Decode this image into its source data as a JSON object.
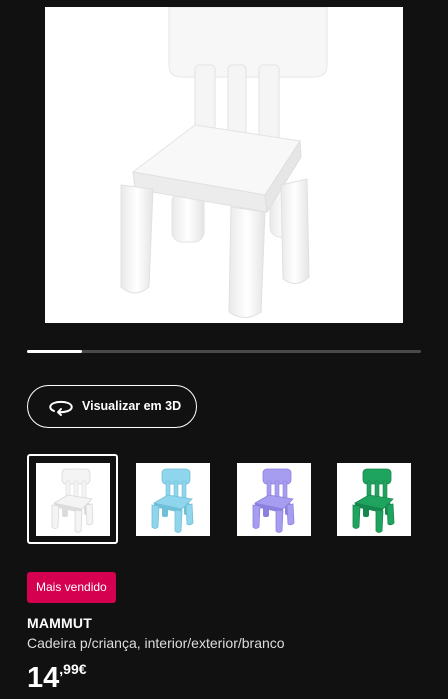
{
  "gallery": {
    "image_alt": "MAMMUT cadeira branca",
    "progress_fraction": 0.14
  },
  "actions": {
    "view_3d_label": "Visualizar em 3D"
  },
  "color_variants": [
    {
      "color": "#f4f4f4",
      "shade": "#dcdcdc",
      "selected": true
    },
    {
      "color": "#8fd6ec",
      "shade": "#6fbfd8",
      "selected": false
    },
    {
      "color": "#a79df0",
      "shade": "#8c80de",
      "selected": false
    },
    {
      "color": "#1fa45f",
      "shade": "#16864c",
      "selected": false
    }
  ],
  "product": {
    "badge": "Mais vendido",
    "name": "MAMMUT",
    "description": "Cadeira p/criança, interior/exterior/branco",
    "price_integer": "14",
    "price_decimal": ",99€"
  },
  "colors": {
    "background": "#111111",
    "badge": "#d5004f",
    "accent_text": "#ffffff"
  }
}
